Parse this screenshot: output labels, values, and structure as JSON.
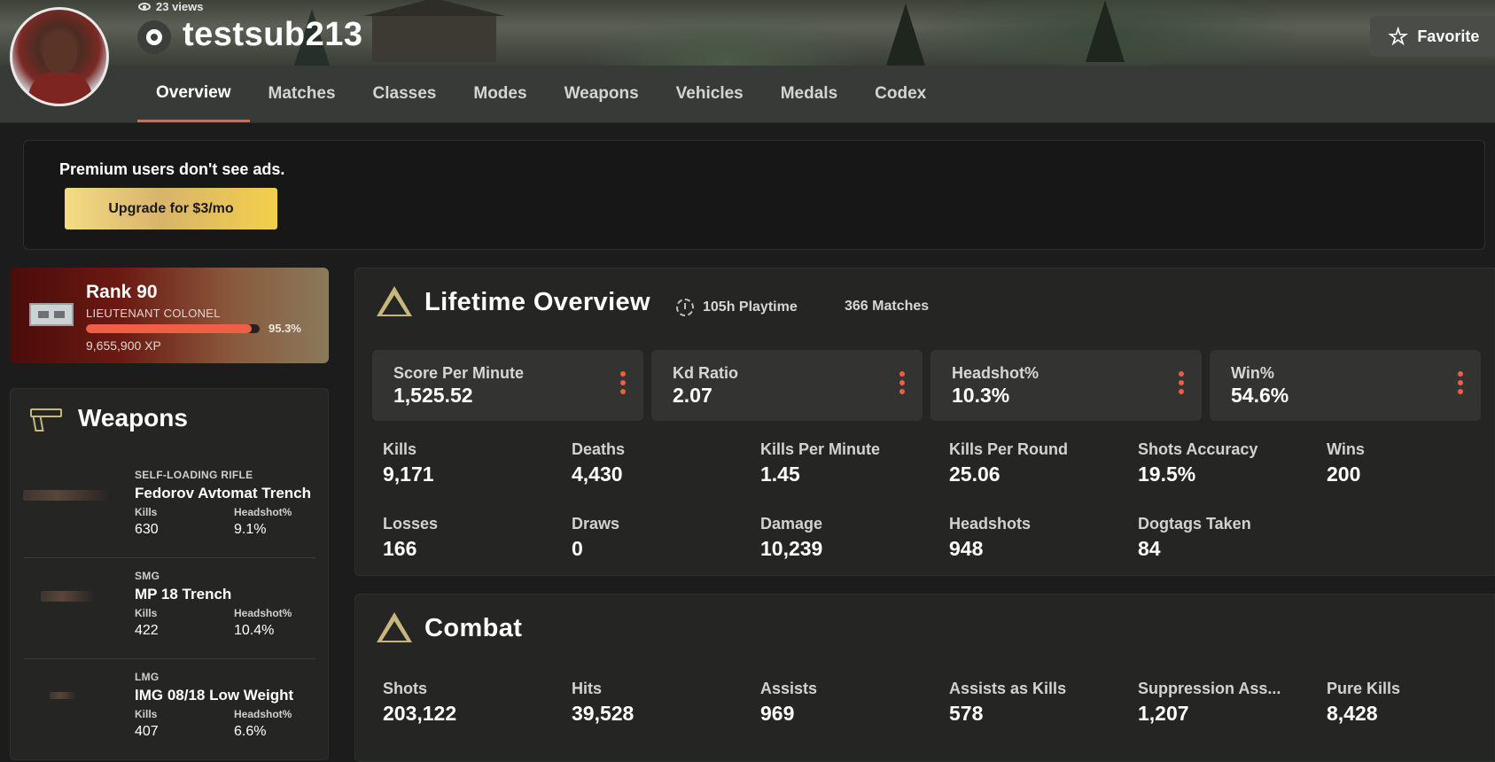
{
  "header": {
    "views": "23 views",
    "username": "testsub213",
    "favorite_label": "Favorite"
  },
  "nav": {
    "tabs": [
      "Overview",
      "Matches",
      "Classes",
      "Modes",
      "Weapons",
      "Vehicles",
      "Medals",
      "Codex"
    ],
    "active": "Overview"
  },
  "ad": {
    "text": "Premium users don't see ads.",
    "button_label": "Upgrade for $3/mo"
  },
  "rank": {
    "title": "Rank 90",
    "subtitle": "LIEUTENANT COLONEL",
    "progress": 0.953,
    "progress_label": "95.3%",
    "xp": "9,655,900 XP"
  },
  "weapons": {
    "title": "Weapons",
    "items": [
      {
        "type": "SELF-LOADING RIFLE",
        "name": "Fedorov Avtomat Trench",
        "kills_label": "Kills",
        "kills": "630",
        "hs_label": "Headshot%",
        "hs": "9.1%"
      },
      {
        "type": "SMG",
        "name": "MP 18 Trench",
        "kills_label": "Kills",
        "kills": "422",
        "hs_label": "Headshot%",
        "hs": "10.4%"
      },
      {
        "type": "LMG",
        "name": "lMG 08/18 Low Weight",
        "kills_label": "Kills",
        "kills": "407",
        "hs_label": "Headshot%",
        "hs": "6.6%"
      }
    ]
  },
  "lifetime": {
    "title": "Lifetime Overview",
    "playtime": "105h Playtime",
    "matches": "366 Matches",
    "highlights": [
      {
        "label": "Score Per Minute",
        "value": "1,525.52"
      },
      {
        "label": "Kd Ratio",
        "value": "2.07"
      },
      {
        "label": "Headshot%",
        "value": "10.3%"
      },
      {
        "label": "Win%",
        "value": "54.6%"
      }
    ],
    "stats": [
      {
        "label": "Kills",
        "value": "9,171"
      },
      {
        "label": "Deaths",
        "value": "4,430"
      },
      {
        "label": "Kills Per Minute",
        "value": "1.45"
      },
      {
        "label": "Kills Per Round",
        "value": "25.06"
      },
      {
        "label": "Shots Accuracy",
        "value": "19.5%"
      },
      {
        "label": "Wins",
        "value": "200"
      },
      {
        "label": "Losses",
        "value": "166"
      },
      {
        "label": "Draws",
        "value": "0"
      },
      {
        "label": "Damage",
        "value": "10,239"
      },
      {
        "label": "Headshots",
        "value": "948"
      },
      {
        "label": "Dogtags Taken",
        "value": "84"
      }
    ]
  },
  "combat": {
    "title": "Combat",
    "stats": [
      {
        "label": "Shots",
        "value": "203,122"
      },
      {
        "label": "Hits",
        "value": "39,528"
      },
      {
        "label": "Assists",
        "value": "969"
      },
      {
        "label": "Assists as Kills",
        "value": "578"
      },
      {
        "label": "Suppression Ass...",
        "value": "1,207"
      },
      {
        "label": "Pure Kills",
        "value": "8,428"
      }
    ]
  },
  "colors": {
    "accent": "#e8614a",
    "gold_icon": "#c8b77d",
    "panel": "#252624",
    "background": "#1b1c1b"
  }
}
